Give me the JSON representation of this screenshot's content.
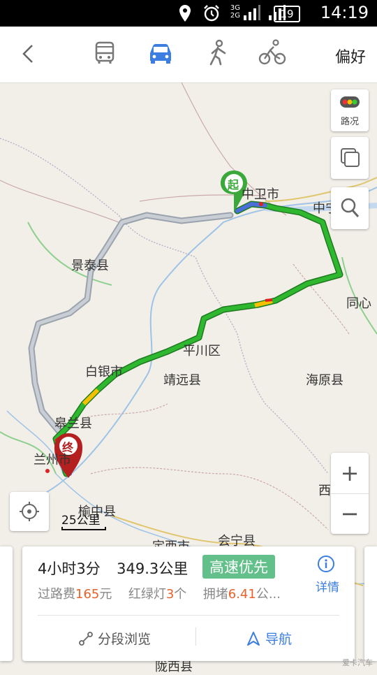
{
  "status_bar": {
    "network": [
      "3G",
      "2G"
    ],
    "battery": "19",
    "time": "14:19"
  },
  "toolbar": {
    "modes": [
      {
        "name": "bus",
        "active": false
      },
      {
        "name": "car",
        "active": true
      },
      {
        "name": "walk",
        "active": false
      },
      {
        "name": "bike",
        "active": false
      }
    ],
    "preference_label": "偏好",
    "accent_color": "#3b7de0"
  },
  "map": {
    "labels": {
      "zhongwei": "中卫市",
      "zhongning": "中宁县",
      "jingtai": "景泰县",
      "tongxin": "同心",
      "pingchuan": "平川区",
      "baiyin": "白银市",
      "jingyuan": "靖远县",
      "haiyuan": "海原县",
      "gaolan": "皋兰县",
      "lanzhou": "兰州市",
      "yuzhong": "榆中县",
      "dingxi": "定西市",
      "huining": "会宁县",
      "xiji": "西",
      "longxi": "陇西县"
    },
    "start_marker": "起",
    "end_marker": "终",
    "traffic_button": "路况",
    "scale": "25公里",
    "route_colors": {
      "smooth": "#2fb82f",
      "slow": "#f5c000",
      "jam": "#e02020",
      "alt": "#9aa3ad"
    }
  },
  "route_card": {
    "duration": "4小时3分",
    "distance": "349.3公里",
    "tag": "高速优先",
    "detail_label": "详情",
    "toll_label": "过路费",
    "toll_value": "165",
    "toll_unit": "元",
    "lights_label": "红绿灯",
    "lights_value": "3",
    "lights_unit": "个",
    "jam_label": "拥堵",
    "jam_value": "6.41",
    "jam_unit": "公...",
    "segment_label": "分段浏览",
    "navigate_label": "导航"
  },
  "watermark": "爱卡汽车"
}
